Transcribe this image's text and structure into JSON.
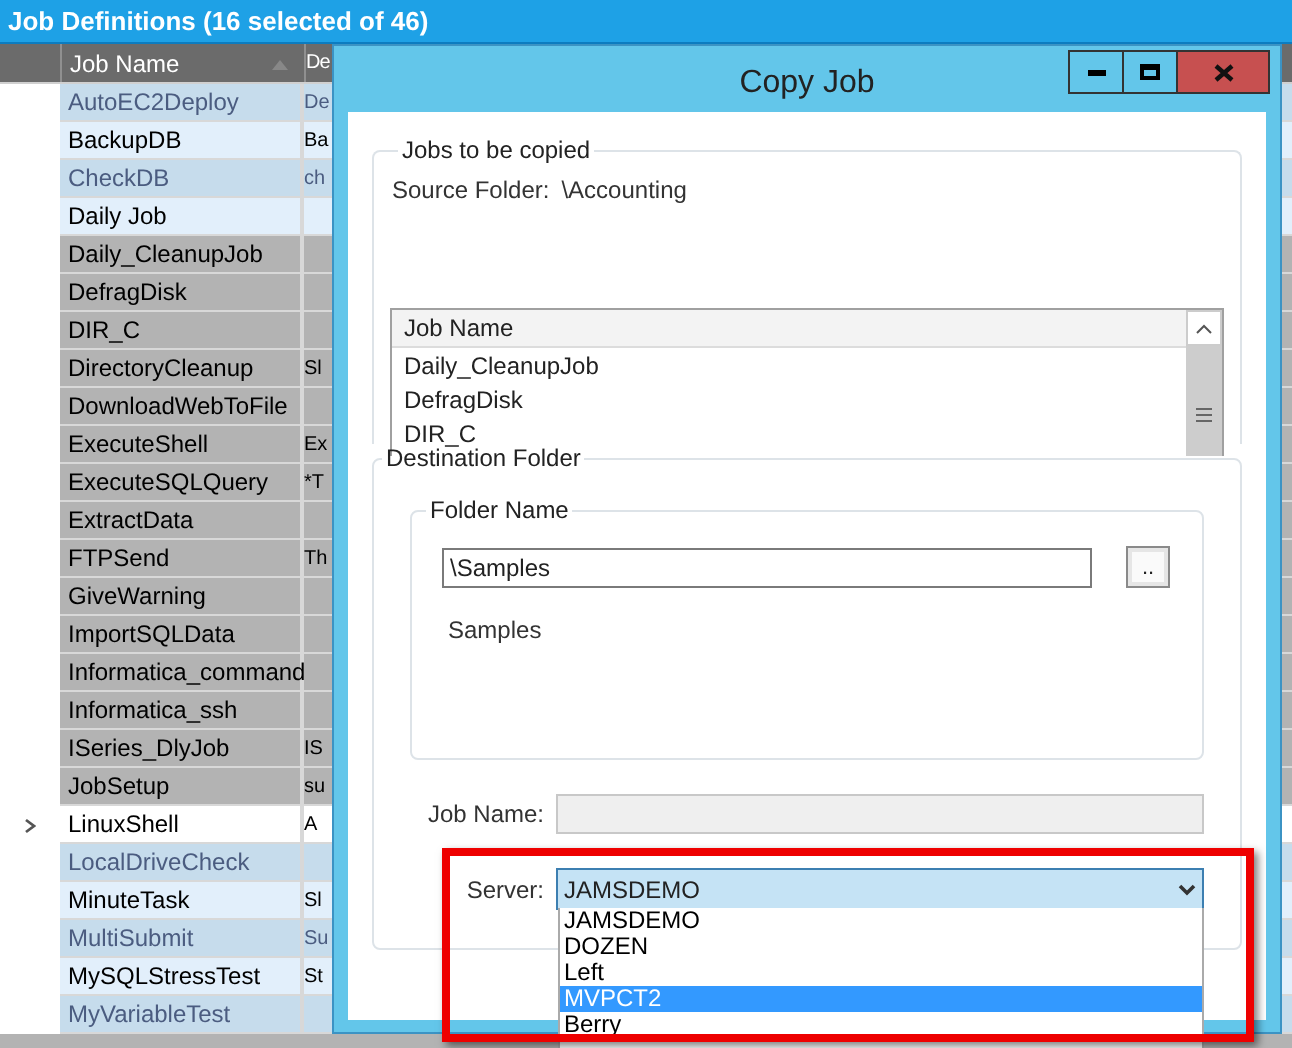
{
  "panel": {
    "title": "Job Definitions (16 selected of 46)"
  },
  "grid": {
    "columns": [
      "Job Name",
      "De"
    ],
    "rows": [
      {
        "name": "AutoEC2Deploy",
        "description": "De",
        "kind": "selected"
      },
      {
        "name": "BackupDB",
        "description": "Ba",
        "kind": "light"
      },
      {
        "name": "CheckDB",
        "description": "ch",
        "kind": "selected"
      },
      {
        "name": "Daily Job",
        "kind": "light"
      },
      {
        "name": "Daily_CleanupJob",
        "kind": "gray"
      },
      {
        "name": "DefragDisk",
        "kind": "gray"
      },
      {
        "name": "DIR_C",
        "kind": "gray"
      },
      {
        "name": "DirectoryCleanup",
        "description": "Sl",
        "kind": "gray"
      },
      {
        "name": "DownloadWebToFile",
        "kind": "gray"
      },
      {
        "name": "ExecuteShell",
        "description": "Ex",
        "kind": "gray"
      },
      {
        "name": "ExecuteSQLQuery",
        "description": "*T",
        "kind": "gray"
      },
      {
        "name": "ExtractData",
        "kind": "gray"
      },
      {
        "name": "FTPSend",
        "description": "Th",
        "kind": "gray"
      },
      {
        "name": "GiveWarning",
        "kind": "gray"
      },
      {
        "name": "ImportSQLData",
        "kind": "gray"
      },
      {
        "name": "Informatica_command",
        "kind": "gray"
      },
      {
        "name": "Informatica_ssh",
        "kind": "gray"
      },
      {
        "name": "ISeries_DlyJob",
        "description": "IS",
        "kind": "gray"
      },
      {
        "name": "JobSetup",
        "description": "su",
        "kind": "gray"
      },
      {
        "name": "LinuxShell",
        "description": "A",
        "kind": "current"
      },
      {
        "name": "LocalDriveCheck",
        "kind": "selected"
      },
      {
        "name": "MinuteTask",
        "description": "Sl",
        "kind": "light"
      },
      {
        "name": "MultiSubmit",
        "description": "Su",
        "kind": "selected"
      },
      {
        "name": "MySQLStressTest",
        "description": "St",
        "kind": "light"
      },
      {
        "name": "MyVariableTest",
        "kind": "selected"
      }
    ]
  },
  "dialog": {
    "title": "Copy Job",
    "jobs_group": {
      "title": "Jobs to be copied",
      "source_label": "Source Folder:",
      "source_value": "\\Accounting",
      "list": {
        "column": "Job Name",
        "rows": [
          "Daily_CleanupJob",
          "DefragDisk",
          "DIR_C"
        ]
      }
    },
    "destination_group": {
      "title": "Destination Folder",
      "folder_group": {
        "title": "Folder Name",
        "value": "\\Samples",
        "browse": "..",
        "folder": "Samples"
      },
      "job_name": {
        "label": "Job Name:"
      },
      "server": {
        "label": "Server:",
        "value": "JAMSDEMO",
        "expanded": true,
        "options": [
          {
            "label": "JAMSDEMO",
            "highlighted": false
          },
          {
            "label": "DOZEN",
            "highlighted": false
          },
          {
            "label": "Left",
            "highlighted": false
          },
          {
            "label": "MVPCT2",
            "highlighted": true
          },
          {
            "label": "Berry",
            "highlighted": false
          }
        ]
      }
    }
  }
}
